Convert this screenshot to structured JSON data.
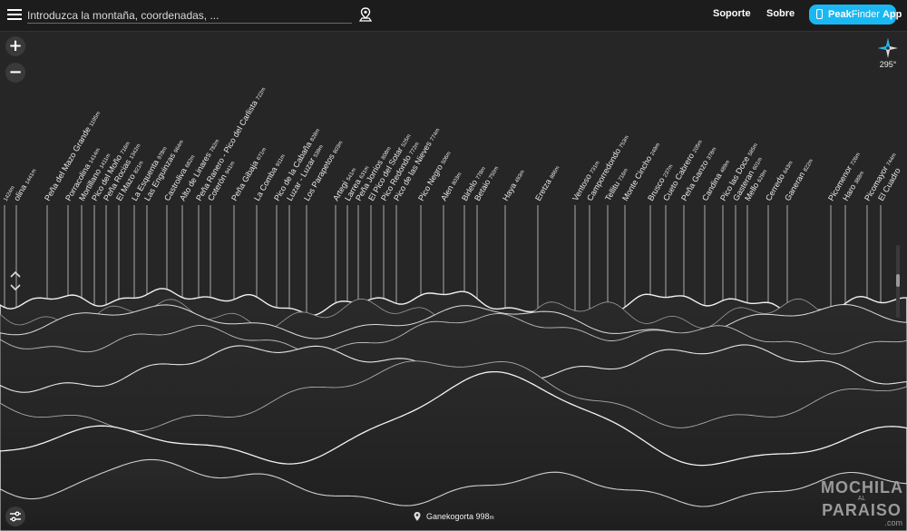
{
  "header": {
    "search_placeholder": "Introduzca la montaña, coordenadas, ...",
    "nav": [
      "Soporte",
      "Sobre"
    ],
    "app_button": {
      "brand_peak": "Peak",
      "brand_finder": "Finder",
      "label": "App",
      "color": "#1ab8f2"
    }
  },
  "controls": {
    "zoom_in": "+",
    "zoom_out": "−",
    "compass_heading": "295°"
  },
  "viewpoint": {
    "name": "Ganekogorta 998",
    "unit": "m"
  },
  "peaks": [
    {
      "name": "",
      "elevation": "1424m"
    },
    {
      "name": "olina",
      "elevation": "1441m"
    },
    {
      "name": "Peña del Mazo Grande",
      "elevation": "1195m"
    },
    {
      "name": "Porracolina",
      "elevation": "1414m"
    },
    {
      "name": "Mortillano",
      "elevation": "1411m"
    },
    {
      "name": "Pico del Moño",
      "elevation": "716m"
    },
    {
      "name": "Peña Rocias",
      "elevation": "1342m"
    },
    {
      "name": "El Mazo",
      "elevation": "821m"
    },
    {
      "name": "La Esquenta",
      "elevation": "978m"
    },
    {
      "name": "Las Enguinzas",
      "elevation": "964m"
    },
    {
      "name": "Castroliva",
      "elevation": "682m"
    },
    {
      "name": "Alto de Linares",
      "elevation": "782m"
    },
    {
      "name": "Peña Ranero - Pico del Carlista",
      "elevation": "722m"
    },
    {
      "name": "Coterón",
      "elevation": "941m"
    },
    {
      "name": "Peña Gibaja",
      "elevation": "671m"
    },
    {
      "name": "La Comba",
      "elevation": "911m"
    },
    {
      "name": "Pico de la Cabaña",
      "elevation": "828m"
    },
    {
      "name": "Luzar - Luzar",
      "elevation": "539m"
    },
    {
      "name": "Los Parapetos",
      "elevation": "803m"
    },
    {
      "name": "Artegi",
      "elevation": "541m"
    },
    {
      "name": "Larrea",
      "elevation": "631m"
    },
    {
      "name": "Peña Jorrios",
      "elevation": "808m"
    },
    {
      "name": "El Pico del Sotar",
      "elevation": "525m"
    },
    {
      "name": "Pico Redondo",
      "elevation": "772m"
    },
    {
      "name": "Pico de las Nieves",
      "elevation": "774m"
    },
    {
      "name": "Pico Negro",
      "elevation": "506m"
    },
    {
      "name": "Alen",
      "elevation": "803m"
    },
    {
      "name": "Birlelo",
      "elevation": "778m"
    },
    {
      "name": "Betaio",
      "elevation": "750m"
    },
    {
      "name": "Haya",
      "elevation": "493m"
    },
    {
      "name": "Eretza",
      "elevation": "886m"
    },
    {
      "name": "Ventoso",
      "elevation": "731m"
    },
    {
      "name": "Camporredondo",
      "elevation": "753m"
    },
    {
      "name": "Tellitu",
      "elevation": "716m"
    },
    {
      "name": "Monte Cincho",
      "elevation": "249m"
    },
    {
      "name": "Brusco",
      "elevation": "237m"
    },
    {
      "name": "Cueto Cabrero",
      "elevation": "205m"
    },
    {
      "name": "Peña Ganzo",
      "elevation": "378m"
    },
    {
      "name": "Candina",
      "elevation": "489m"
    },
    {
      "name": "Pico las Doce",
      "elevation": "585m"
    },
    {
      "name": "Gasteran",
      "elevation": "601m"
    },
    {
      "name": "Mello",
      "elevation": "629m"
    },
    {
      "name": "Cerredo",
      "elevation": "643m"
    },
    {
      "name": "Ganeran",
      "elevation": "822m"
    },
    {
      "name": "Picomenor",
      "elevation": "726m"
    },
    {
      "name": "Haro",
      "elevation": "388m"
    },
    {
      "name": "Picomayor",
      "elevation": "744m"
    },
    {
      "name": "El Cuadro",
      "elevation": ""
    }
  ],
  "watermark": {
    "line1": "MOCHILA",
    "small": "AL",
    "line2": "PARAISO",
    "suffix": ".com"
  }
}
